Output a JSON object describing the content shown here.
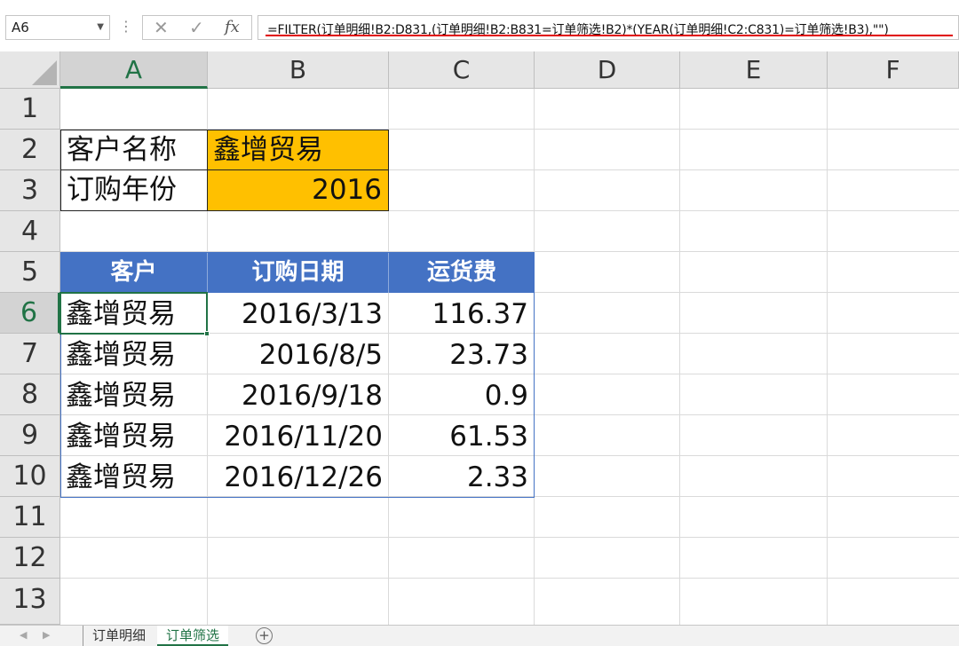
{
  "formula_bar": {
    "name_box": "A6",
    "cancel_icon": "✕",
    "enter_icon": "✓",
    "fx_label": "fx",
    "formula": "=FILTER(订单明细!B2:D831,(订单明细!B2:B831=订单筛选!B2)*(YEAR(订单明细!C2:C831)=订单筛选!B3),\"\")",
    "underline_color": "#e00000"
  },
  "columns": [
    "A",
    "B",
    "C",
    "D",
    "E",
    "F"
  ],
  "active_column": "A",
  "rows": [
    "1",
    "2",
    "3",
    "4",
    "5",
    "6",
    "7",
    "8",
    "9",
    "10",
    "11",
    "12",
    "13"
  ],
  "active_row": "6",
  "criteria": {
    "customer_label": "客户名称",
    "customer_value": "鑫增贸易",
    "year_label": "订购年份",
    "year_value": "2016",
    "input_color": "#ffc000"
  },
  "result_table": {
    "header_color": "#4472c4",
    "headers": [
      "客户",
      "订购日期",
      "运货费"
    ],
    "rows": [
      [
        "鑫增贸易",
        "2016/3/13",
        "116.37"
      ],
      [
        "鑫增贸易",
        "2016/8/5",
        "23.73"
      ],
      [
        "鑫增贸易",
        "2016/9/18",
        "0.9"
      ],
      [
        "鑫增贸易",
        "2016/11/20",
        "61.53"
      ],
      [
        "鑫增贸易",
        "2016/12/26",
        "2.33"
      ]
    ]
  },
  "sheet_tabs": {
    "tabs": [
      "订单明细",
      "订单筛选"
    ],
    "active": "订单筛选",
    "nav_prev_icon": "◀",
    "nav_next_icon": "▶",
    "add_icon": "+"
  },
  "accent_color": "#217346"
}
